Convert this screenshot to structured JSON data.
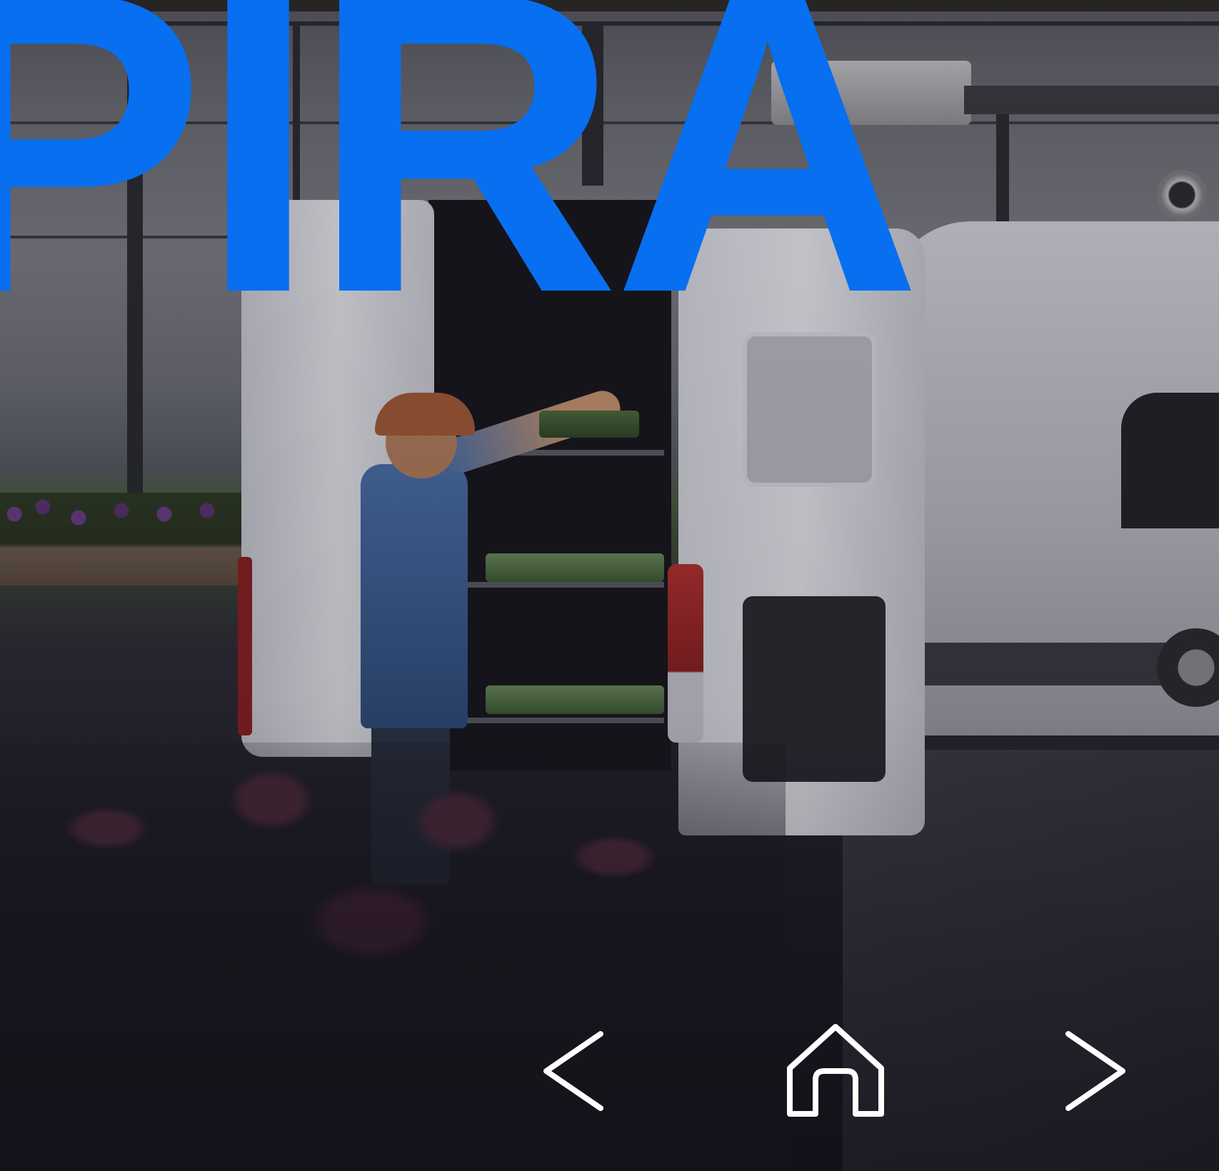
{
  "hero": {
    "headline": "PIRA",
    "headline_color": "#076ff0",
    "image": "greenhouse-worker-loading-plants-into-white-cargo-van"
  },
  "nav": {
    "prev": {
      "icon": "chevron-left-icon",
      "label": ""
    },
    "home": {
      "icon": "home-icon",
      "label": ""
    },
    "next": {
      "icon": "chevron-right-icon",
      "label": ""
    },
    "icon_color": "#ffffff"
  }
}
